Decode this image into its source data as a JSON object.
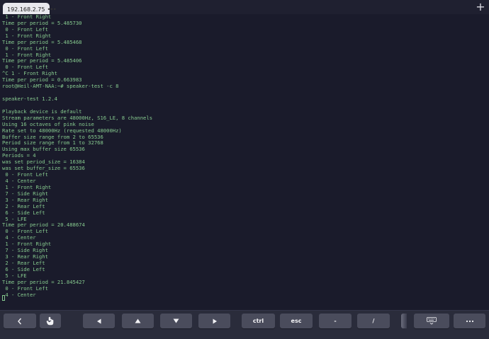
{
  "tab": {
    "title": "192.168.2.75",
    "more": "•••",
    "new_tab": "+"
  },
  "terminal": {
    "lines": [
      " 1 - Front Right",
      "Time per period = 5.485730",
      " 0 - Front Left",
      " 1 - Front Right",
      "Time per period = 5.485468",
      " 0 - Front Left",
      " 1 - Front Right",
      "Time per period = 5.485406",
      " 0 - Front Left",
      "^C 1 - Front Right",
      "Time per period = 0.663983",
      "root@Heil-AMT-NAA:~# speaker-test -c 8",
      "",
      "speaker-test 1.2.4",
      "",
      "Playback device is default",
      "Stream parameters are 48000Hz, S16_LE, 8 channels",
      "Using 16 octaves of pink noise",
      "Rate set to 48000Hz (requested 48000Hz)",
      "Buffer size range from 2 to 65536",
      "Period size range from 1 to 32768",
      "Using max buffer size 65536",
      "Periods = 4",
      "was set period_size = 16384",
      "was set buffer_size = 65536",
      " 0 - Front Left",
      " 4 - Center",
      " 1 - Front Right",
      " 7 - Side Right",
      " 3 - Rear Right",
      " 2 - Rear Left",
      " 6 - Side Left",
      " 5 - LFE",
      "Time per period = 20.488674",
      " 0 - Front Left",
      " 4 - Center",
      " 1 - Front Right",
      " 7 - Side Right",
      " 3 - Rear Right",
      " 2 - Rear Left",
      " 6 - Side Left",
      " 5 - LFE",
      "Time per period = 21.845427",
      " 0 - Front Left",
      " 4 - Center"
    ]
  },
  "toolbar": {
    "keys": [
      {
        "name": "back-key",
        "icon": "chevron-left-icon"
      },
      {
        "name": "touch-key",
        "icon": "hand-pointer-icon"
      },
      {
        "name": "arrow-left-key",
        "icon": "triangle-left-icon"
      },
      {
        "name": "arrow-up-key",
        "icon": "triangle-up-icon"
      },
      {
        "name": "arrow-down-key",
        "icon": "triangle-down-icon"
      },
      {
        "name": "arrow-right-key",
        "icon": "triangle-right-icon"
      },
      {
        "name": "ctrl-key",
        "label": "ctrl"
      },
      {
        "name": "esc-key",
        "label": "esc"
      },
      {
        "name": "dash-key",
        "label": "-"
      },
      {
        "name": "slash-key",
        "label": "/"
      },
      {
        "name": "keyboard-toggle-key",
        "icon": "keyboard-icon"
      },
      {
        "name": "more-key",
        "icon": "more-dots-icon"
      }
    ]
  }
}
